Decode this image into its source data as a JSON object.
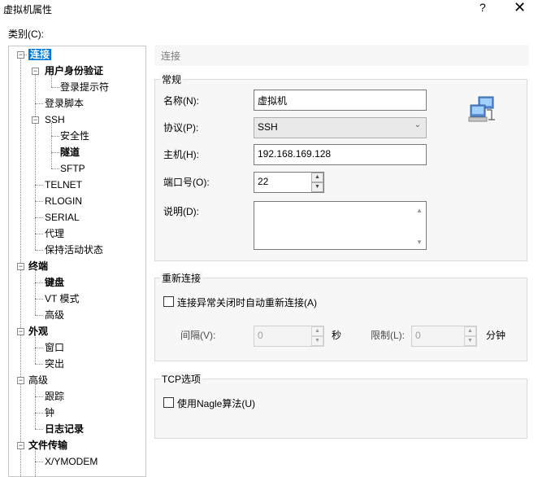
{
  "window": {
    "title": "虚拟机属性",
    "help": "?",
    "close": "✕"
  },
  "category_label": "类别(C):",
  "tree": {
    "connection": "连接",
    "user_auth": "用户身份验证",
    "login_prompt": "登录提示符",
    "login_script": "登录脚本",
    "ssh": "SSH",
    "security": "安全性",
    "tunnel": "隧道",
    "sftp": "SFTP",
    "telnet": "TELNET",
    "rlogin": "RLOGIN",
    "serial": "SERIAL",
    "proxy": "代理",
    "keepalive": "保持活动状态",
    "terminal": "终端",
    "keyboard": "键盘",
    "vt_mode": "VT 模式",
    "advanced_term": "高级",
    "appearance": "外观",
    "window": "窗口",
    "highlight": "突出",
    "advanced": "高级",
    "trace": "跟踪",
    "bell": "钟",
    "logging": "日志记录",
    "file_transfer": "文件传输",
    "xymodem": "X/YMODEM"
  },
  "panel_title": "连接",
  "general": {
    "title": "常规",
    "name_label": "名称(N):",
    "name_value": "虚拟机",
    "protocol_label": "协议(P):",
    "protocol_value": "SSH",
    "host_label": "主机(H):",
    "host_value": "192.168.169.128",
    "port_label": "端口号(O):",
    "port_value": "22",
    "desc_label": "说明(D):",
    "desc_value": ""
  },
  "reconnect": {
    "title": "重新连接",
    "checkbox_label": "连接异常关闭时自动重新连接(A)",
    "interval_label": "间隔(V):",
    "interval_value": "0",
    "interval_unit": "秒",
    "limit_label": "限制(L):",
    "limit_value": "0",
    "limit_unit": "分钟"
  },
  "tcp": {
    "title": "TCP选项",
    "nagle_label": "使用Nagle算法(U)"
  },
  "icons": {
    "network": "network-computers-icon"
  }
}
